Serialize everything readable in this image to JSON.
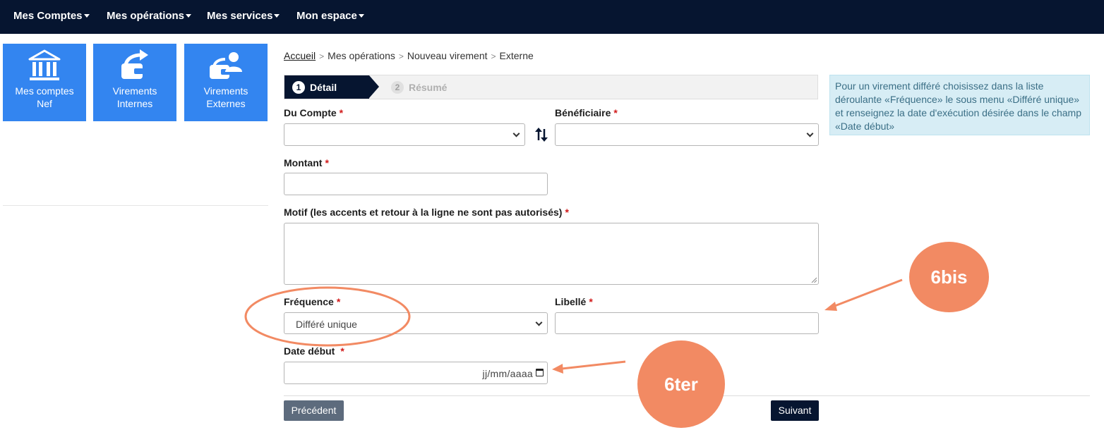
{
  "nav": {
    "items": [
      {
        "label": "Mes Comptes"
      },
      {
        "label": "Mes opérations"
      },
      {
        "label": "Mes services"
      },
      {
        "label": "Mon espace"
      }
    ]
  },
  "sidebar": {
    "tiles": [
      {
        "line1": "Mes comptes",
        "line2": "Nef",
        "icon": "bank-icon"
      },
      {
        "line1": "Virements",
        "line2": "Internes",
        "icon": "wallet-transfer-icon"
      },
      {
        "line1": "Virements",
        "line2": "Externes",
        "icon": "wallet-user-icon"
      }
    ]
  },
  "breadcrumb": {
    "home": "Accueil",
    "items": [
      "Mes opérations",
      "Nouveau virement",
      "Externe"
    ],
    "separator": ">"
  },
  "stepper": {
    "steps": [
      {
        "number": "1",
        "label": "Détail"
      },
      {
        "number": "2",
        "label": "Résumé"
      }
    ]
  },
  "info": {
    "text": "Pour un virement différé choisissez dans la liste déroulante «Fréquence» le sous menu «Différé unique» et renseignez la date d'exécution désirée dans le champ «Date début»"
  },
  "form": {
    "required_mark": "*",
    "from_account": {
      "label": "Du Compte",
      "value": ""
    },
    "beneficiary": {
      "label": "Bénéficiaire",
      "value": ""
    },
    "amount": {
      "label": "Montant",
      "value": ""
    },
    "reason": {
      "label": "Motif (les accents et retour à la ligne ne sont pas autorisés)",
      "value": ""
    },
    "frequency": {
      "label": "Fréquence",
      "value": "Différé unique"
    },
    "wording": {
      "label": "Libellé",
      "value": ""
    },
    "start_date": {
      "label": "Date début",
      "placeholder": "jj/mm/aaaa"
    }
  },
  "buttons": {
    "previous": "Précédent",
    "next": "Suivant"
  },
  "annotations": {
    "bubble_a": "6bis",
    "bubble_b": "6ter",
    "color": "#f28a63"
  },
  "colors": {
    "topbar": "#061530",
    "tile": "#3385f0",
    "info_bg": "#d7edf5",
    "required": "#d11a1a"
  }
}
